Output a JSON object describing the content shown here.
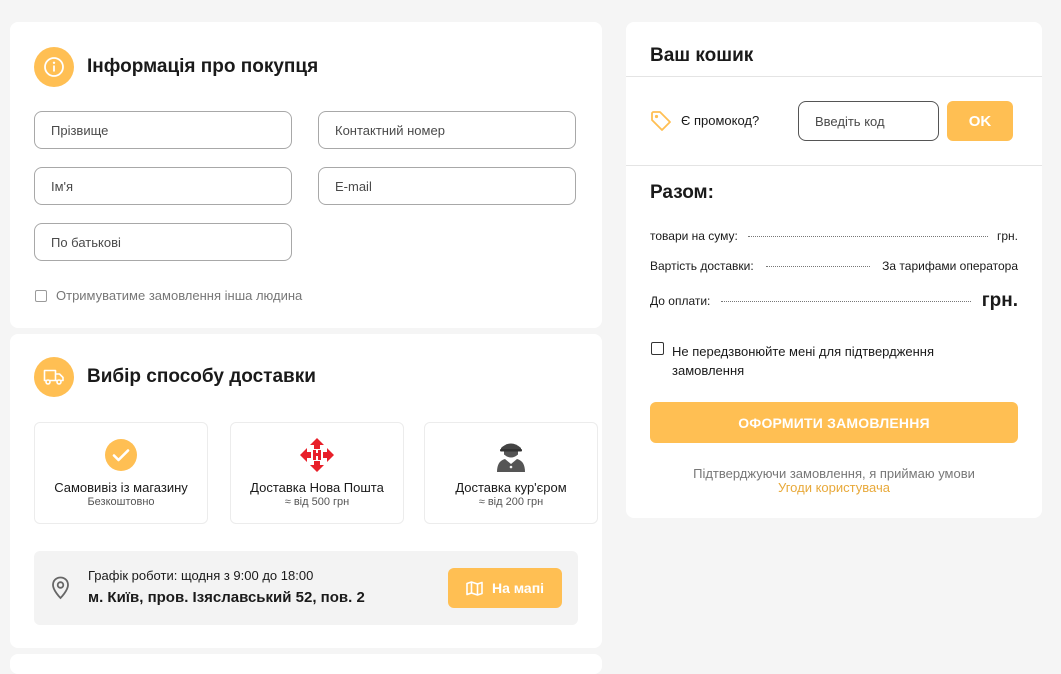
{
  "buyer": {
    "title": "Інформація про покупця",
    "fields": {
      "last_name": "Прізвище",
      "phone": "Контактний номер",
      "first_name": "Ім'я",
      "email": "E-mail",
      "patronymic": "По батькові"
    },
    "other_person_label": "Отримуватиме замовлення інша людина"
  },
  "delivery": {
    "title": "Вибір способу доставки",
    "options": [
      {
        "name": "Самовивіз із магазину",
        "sub": "Безкоштовно",
        "icon": "check-circle-icon",
        "selected": true
      },
      {
        "name": "Доставка Нова Пошта",
        "sub": "≈ від 500 грн",
        "icon": "nova-poshta-logo-icon"
      },
      {
        "name": "Доставка кур'єром",
        "sub": "≈ від 200 грн",
        "icon": "courier-icon"
      }
    ],
    "pickup": {
      "schedule": "Графік роботи: щодня з 9:00 до 18:00",
      "address": "м. Київ, пров. Ізяславський 52, пов. 2",
      "map_button": "На мапі"
    }
  },
  "cart": {
    "title": "Ваш кошик",
    "promo_label": "Є промокод?",
    "promo_placeholder": "Введіть код",
    "promo_ok": "OK",
    "total_title": "Разом:",
    "rows": {
      "goods_label": "товари на суму:",
      "goods_value": "грн.",
      "delivery_label": "Вартість доставки:",
      "delivery_value": "За тарифами оператора",
      "pay_label": "До оплати:",
      "pay_value": "грн."
    },
    "no_call_label_line1": "Не передзвонюйте мені для підтвердження",
    "no_call_label_line2": "замовлення",
    "submit": "ОФОРМИТИ ЗАМОВЛЕННЯ",
    "terms_text": "Підтверджуючи замовлення, я приймаю умови",
    "terms_link": "Угоди користувача"
  },
  "colors": {
    "accent": "#ffbf53",
    "background": "#f5f5f5",
    "link": "#e8a93a",
    "nova_poshta_red": "#e8202a"
  }
}
